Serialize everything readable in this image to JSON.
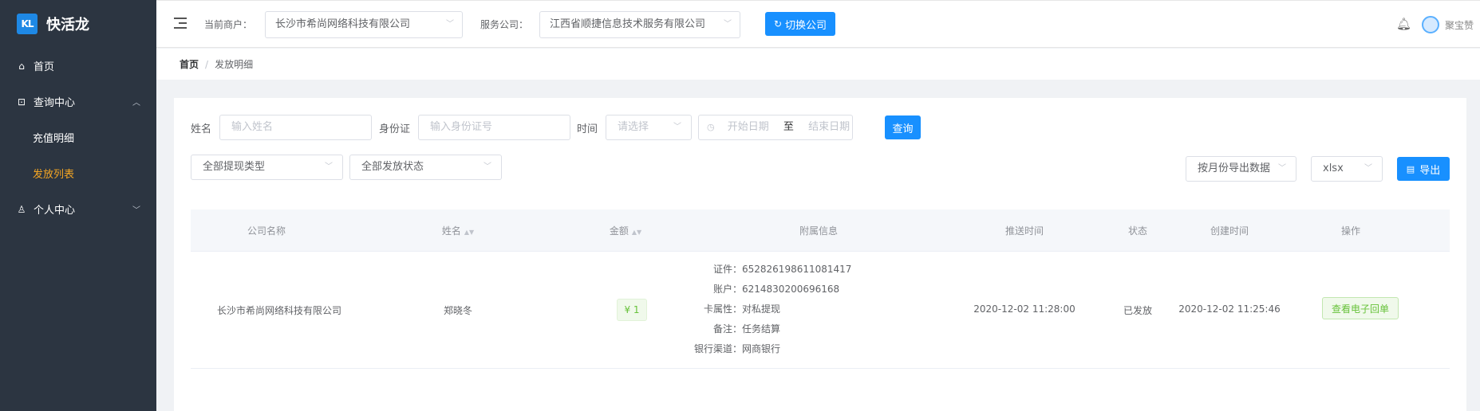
{
  "app": {
    "logo_mark": "KL",
    "name": "快活龙"
  },
  "sidebar": {
    "items": [
      {
        "label": "首页",
        "icon": "home-icon"
      },
      {
        "label": "查询中心",
        "icon": "search-center-icon",
        "expanded": true,
        "children": [
          {
            "label": "充值明细"
          },
          {
            "label": "发放列表",
            "active": true
          }
        ]
      },
      {
        "label": "个人中心",
        "icon": "user-icon",
        "expanded": false
      }
    ]
  },
  "header": {
    "merchant_label": "当前商户：",
    "merchant_value": "长沙市希尚网络科技有限公司",
    "service_label": "服务公司：",
    "service_value": "江西省顺捷信息技术服务有限公司",
    "switch_label": "切换公司",
    "username": "聚宝赞"
  },
  "breadcrumb": {
    "home": "首页",
    "separator": "/",
    "current": "发放明细"
  },
  "filters": {
    "name_label": "姓名",
    "name_placeholder": "输入姓名",
    "id_label": "身份证",
    "id_placeholder": "输入身份证号",
    "time_label": "时间",
    "time_select_placeholder": "请选择",
    "start_date_placeholder": "开始日期",
    "date_separator": "至",
    "end_date_placeholder": "结束日期",
    "query_label": "查询",
    "withdraw_type": "全部提现类型",
    "issue_status": "全部发放状态",
    "export_mode": "按月份导出数据",
    "export_format": "xlsx",
    "export_label": "导出"
  },
  "table": {
    "columns": [
      "公司名称",
      "姓名",
      "金额",
      "附属信息",
      "推送时间",
      "状态",
      "创建时间",
      "操作"
    ],
    "rows": [
      {
        "company": "长沙市希尚网络科技有限公司",
        "name": "郑晓冬",
        "amount": "¥ 1",
        "info": [
          {
            "k": "证件：",
            "v": "652826198611081417"
          },
          {
            "k": "账户：",
            "v": "6214830200696168"
          },
          {
            "k": "卡属性：",
            "v": "对私提现"
          },
          {
            "k": "备注：",
            "v": "任务结算"
          },
          {
            "k": "银行渠道：",
            "v": "网商银行"
          }
        ],
        "push_time": "2020-12-02 11:28:00",
        "status": "已发放",
        "created_time": "2020-12-02 11:25:46",
        "action": "查看电子回单"
      }
    ]
  },
  "colors": {
    "primary": "#1890ff",
    "sidebar_bg": "#2c3541",
    "active_menu": "#f5a623",
    "success": "#67c23a"
  }
}
